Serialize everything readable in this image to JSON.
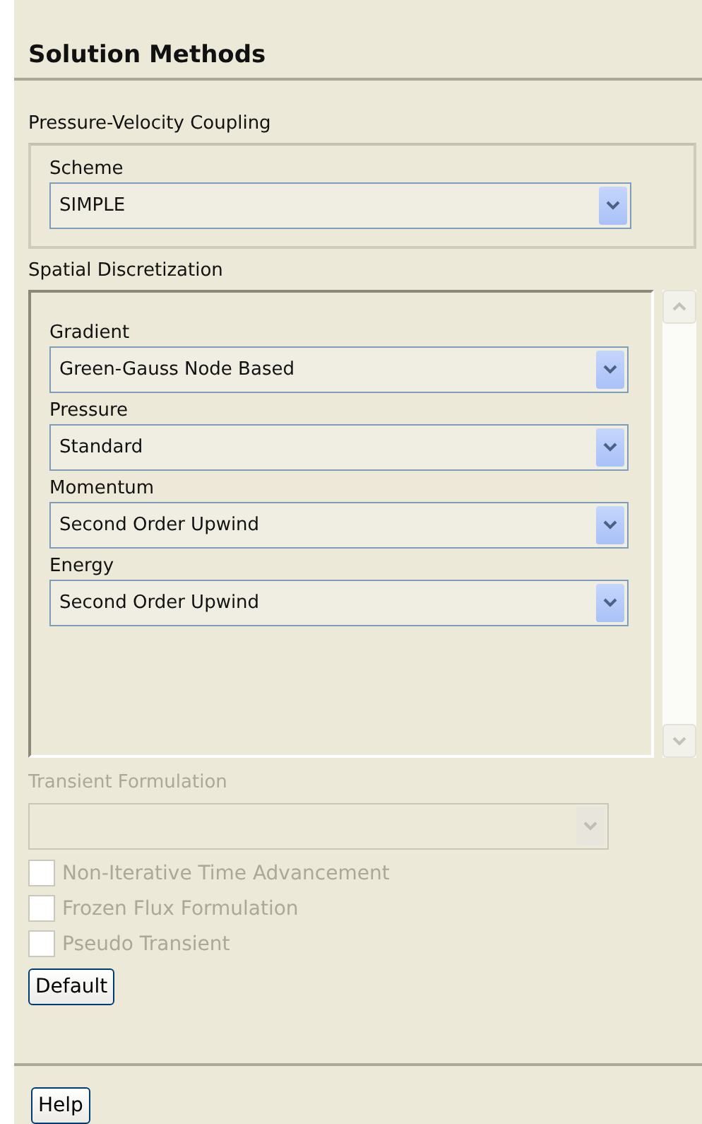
{
  "title": "Solution Methods",
  "pressure_velocity_coupling": {
    "label": "Pressure-Velocity Coupling",
    "fields": [
      {
        "label": "Scheme",
        "value": "SIMPLE",
        "disabled": false
      }
    ]
  },
  "spatial_discretization": {
    "label": "Spatial Discretization",
    "fields": [
      {
        "label": "Gradient",
        "value": "Green-Gauss Node Based",
        "disabled": false
      },
      {
        "label": "Pressure",
        "value": "Standard",
        "disabled": false
      },
      {
        "label": "Momentum",
        "value": "Second Order Upwind",
        "disabled": false
      },
      {
        "label": "Energy",
        "value": "Second Order Upwind",
        "disabled": false
      }
    ]
  },
  "transient_formulation": {
    "label": "Transient Formulation",
    "disabled": true
  },
  "options": [
    {
      "label": "Non-Iterative Time Advancement",
      "checked": false,
      "disabled": true
    },
    {
      "label": "Frozen Flux Formulation",
      "checked": false,
      "disabled": true
    },
    {
      "label": "Pseudo Transient",
      "checked": false,
      "disabled": true
    }
  ],
  "default_button": "Default",
  "help_button": "Help"
}
